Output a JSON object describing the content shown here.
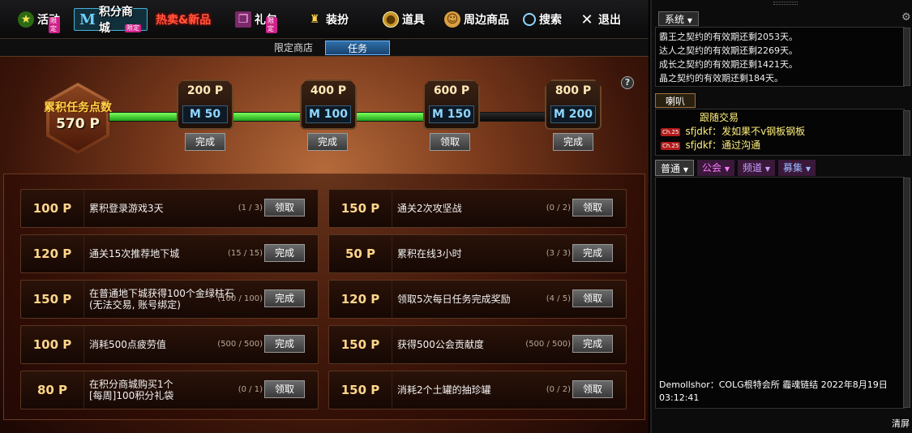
{
  "menu": {
    "activity": "活动",
    "activity_tag": "限定",
    "shop": "积分商城",
    "shop_tag": "限定",
    "hot": "热卖&新品",
    "gift": "礼包",
    "gift_tag": "限定",
    "dress": "装扮",
    "items": "道具",
    "merch": "周边商品",
    "search": "搜索",
    "exit": "退出"
  },
  "subtabs": {
    "shop": "限定商店",
    "task": "任务"
  },
  "progress": {
    "title": "累积任务点数",
    "total": "570 P",
    "help": "?",
    "milestones": [
      {
        "points": "200 P",
        "reward": "50",
        "button": "完成"
      },
      {
        "points": "400 P",
        "reward": "100",
        "button": "完成"
      },
      {
        "points": "600 P",
        "reward": "150",
        "button": "领取"
      },
      {
        "points": "800 P",
        "reward": "200",
        "button": "完成"
      }
    ],
    "m_symbol": "M"
  },
  "tasks": [
    {
      "points": "100  P",
      "desc": "累积登录游戏3天",
      "progress": "(1 / 3)",
      "button": "领取"
    },
    {
      "points": "150  P",
      "desc": "通关2次攻坚战",
      "progress": "(0 / 2)",
      "button": "领取"
    },
    {
      "points": "120  P",
      "desc": "通关15次推荐地下城",
      "progress": "(15 / 15)",
      "button": "完成"
    },
    {
      "points": "50  P",
      "desc": "累积在线3小时",
      "progress": "(3 / 3)",
      "button": "完成"
    },
    {
      "points": "150  P",
      "desc": "在普通地下城获得100个金绿柱石\n(无法交易, 账号绑定)",
      "progress": "(100 / 100)",
      "button": "完成"
    },
    {
      "points": "120  P",
      "desc": "领取5次每日任务完成奖励",
      "progress": "(4 / 5)",
      "button": "领取"
    },
    {
      "points": "100  P",
      "desc": "消耗500点疲劳值",
      "progress": "(500 / 500)",
      "button": "完成"
    },
    {
      "points": "150  P",
      "desc": "获得500公会贡献度",
      "progress": "(500 / 500)",
      "button": "完成"
    },
    {
      "points": "80  P",
      "desc": "在积分商城购买1个\n[每周]100积分礼袋",
      "progress": "(0 / 1)",
      "button": "领取"
    },
    {
      "points": "150  P",
      "desc": "消耗2个土罐的抽珍罐",
      "progress": "(0 / 2)",
      "button": "领取"
    }
  ],
  "chat": {
    "system_tab": "系统",
    "system_lines": [
      "霸王之契约的有效期还剩2053天。",
      "达人之契约的有效期还剩2269天。",
      "成长之契约的有效期还剩1421天。",
      "晶之契约的有效期还剩184天。"
    ],
    "horn_tab": "喇叭",
    "horn_head": "跟随交易",
    "horn_lines": [
      {
        "badge": "Ch.25",
        "text": "sfjdkf：发如果不v钢板钢板"
      },
      {
        "badge": "Ch.25",
        "text": "sfjdkf：通过沟通"
      }
    ],
    "tabs": [
      "普通",
      "公会",
      "频道",
      "募集"
    ],
    "message": "Demollshor：COLG根特会所 霾魂链结 2022年8月19日 03:12:41",
    "clear": "清屏"
  }
}
